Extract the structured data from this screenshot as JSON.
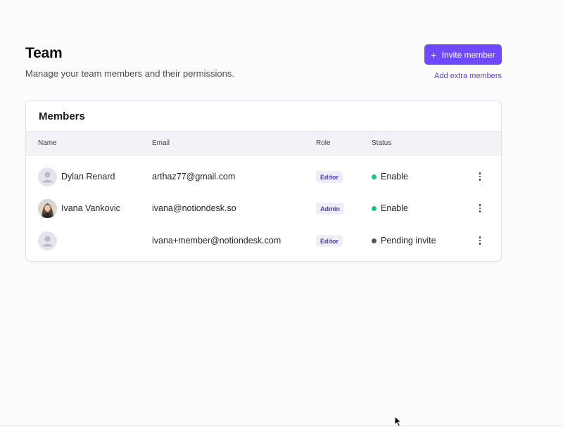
{
  "header": {
    "title": "Team",
    "subtitle": "Manage your team members and their permissions.",
    "invite_label": "Invite member",
    "extra_link": "Add extra members"
  },
  "members": {
    "title": "Members",
    "columns": [
      "Name",
      "Email",
      "Role",
      "Status"
    ],
    "rows": [
      {
        "name": "Dylan Renard",
        "email": "arthaz77@gmail.com",
        "role": "Editor",
        "status": "Enable",
        "avatar": "placeholder-avatar-icon"
      },
      {
        "name": "Ivana Vankovic",
        "email": "ivana@notiondesk.so",
        "role": "Admin",
        "status": "Enable",
        "avatar": "photo"
      },
      {
        "name": "",
        "email": "ivana+member@notiondesk.com",
        "role": "Editor",
        "status": "Pending invite",
        "avatar": "placeholder-avatar-icon"
      }
    ]
  },
  "colors": {
    "accent": "#6d4aff",
    "enable": "#22c07a",
    "pending": "#55555e"
  }
}
